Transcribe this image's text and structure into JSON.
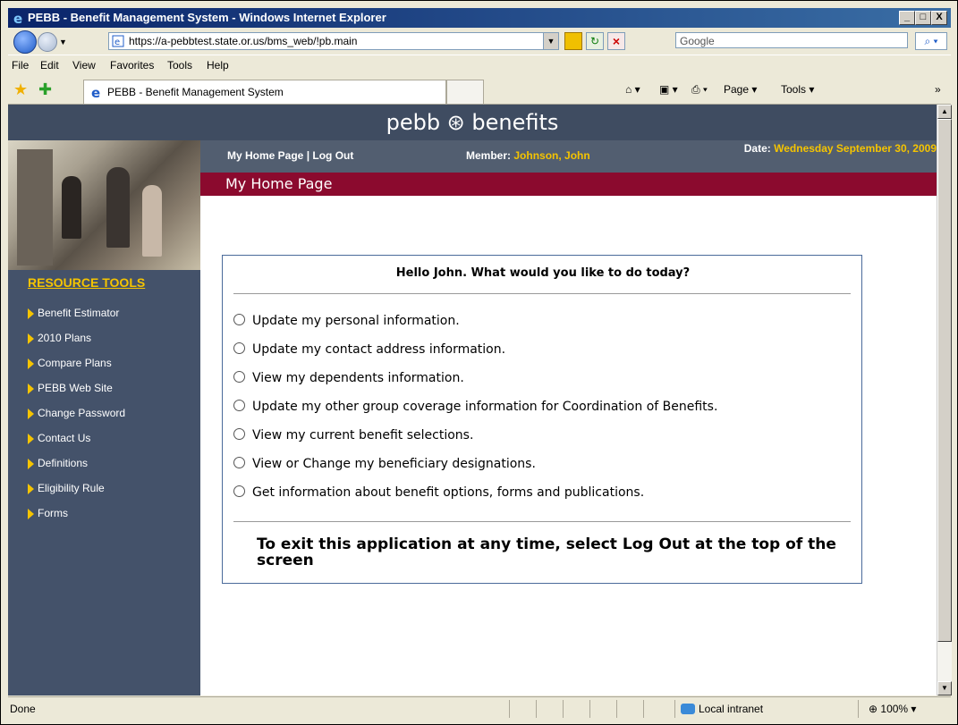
{
  "window": {
    "title": "PEBB - Benefit Management System - Windows Internet Explorer",
    "minimize": "_",
    "maximize": "□",
    "close": "X"
  },
  "toolbar": {
    "url": "https://a-pebbtest.state.or.us/bms_web/!pb.main",
    "search_placeholder": "Google",
    "search_icon": "search-icon"
  },
  "menubar": [
    "File",
    "Edit",
    "View",
    "Favorites",
    "Tools",
    "Help"
  ],
  "tabs": {
    "active_tab": "PEBB - Benefit Management System",
    "commands": [
      "Page",
      "Tools"
    ]
  },
  "page": {
    "logo_text": "pebb ⊛ benefits",
    "nav_links": "My Home Page | Log Out",
    "member_label": "Member:",
    "member_name": "Johnson, John",
    "date_label": "Date:",
    "date_value": "Wednesday September 30, 2009",
    "title": "My Home Page",
    "greeting": "Hello John. What would you like to do today?",
    "options": [
      "Update my personal information.",
      "Update my contact address information.",
      "View my dependents information.",
      "Update my other group coverage information for Coordination of Benefits.",
      "View my current benefit selections.",
      "View or Change my beneficiary designations.",
      "Get information about benefit options, forms and publications."
    ],
    "exit_note": "To exit this application at any time, select Log Out at the top of the screen"
  },
  "sidebar": {
    "title": "RESOURCE TOOLS",
    "items": [
      "Benefit Estimator",
      "2010 Plans",
      "Compare Plans",
      "PEBB Web Site",
      "Change Password",
      "Contact Us",
      "Definitions",
      "Eligibility Rule",
      "Forms"
    ]
  },
  "status": {
    "left": "Done",
    "zone": "Local intranet",
    "zoom": "100%"
  },
  "colors": {
    "header_bg": "#3f4c61",
    "sidebar_bg": "#44526a",
    "title_bar_bg": "#8b0a2e",
    "accent_yellow": "#f5c400"
  }
}
